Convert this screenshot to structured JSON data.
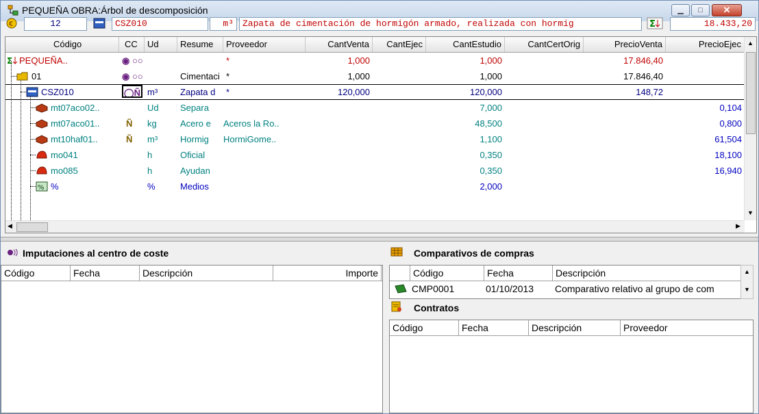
{
  "window": {
    "title": "PEQUEÑA OBRA:Árbol de descomposición"
  },
  "toolbar": {
    "quantity": "12",
    "code": "CSZ010",
    "unit": "m³",
    "description": "Zapata de cimentación de hormigón armado, realizada con hormig",
    "total": "18.433,20"
  },
  "grid": {
    "columns": [
      "Código",
      "CC",
      "Ud",
      "Resume",
      "Proveedor",
      "CantVenta",
      "CantEjec",
      "CantEstudio",
      "CantCertOrig",
      "PrecioVenta",
      "PrecioEjec"
    ],
    "rows": [
      {
        "code": "PEQUEÑA..",
        "ud": "",
        "resumen": "",
        "proveedor": "*",
        "cantventa": "1,000",
        "cantejec": "",
        "cantestudio": "1,000",
        "cantcert": "",
        "precioventa": "17.846,40",
        "precioejec": "",
        "color": "#c00000"
      },
      {
        "code": "01",
        "ud": "",
        "resumen": "Cimentaci",
        "proveedor": "*",
        "cantventa": "1,000",
        "cantejec": "",
        "cantestudio": "1,000",
        "cantcert": "",
        "precioventa": "17.846,40",
        "precioejec": "",
        "color": "#000000"
      },
      {
        "code": "CSZ010",
        "ud": "m³",
        "resumen": "Zapata d",
        "proveedor": "*",
        "cantventa": "120,000",
        "cantejec": "",
        "cantestudio": "120,000",
        "cantcert": "",
        "precioventa": "148,72",
        "precioejec": "",
        "color": "#000080"
      },
      {
        "code": "mt07aco02..",
        "ud": "Ud",
        "resumen": "Separa",
        "proveedor": "",
        "cantventa": "",
        "cantejec": "",
        "cantestudio": "7,000",
        "cantcert": "",
        "precioventa": "",
        "precioejec": "0,104",
        "color": "#008080"
      },
      {
        "code": "mt07aco01..",
        "ud": "kg",
        "resumen": "Acero e",
        "proveedor": "Aceros la Ro..",
        "cantventa": "",
        "cantejec": "",
        "cantestudio": "48,500",
        "cantcert": "",
        "precioventa": "",
        "precioejec": "0,800",
        "color": "#008080"
      },
      {
        "code": "mt10haf01..",
        "ud": "m³",
        "resumen": "Hormig",
        "proveedor": "HormiGome..",
        "cantventa": "",
        "cantejec": "",
        "cantestudio": "1,100",
        "cantcert": "",
        "precioventa": "",
        "precioejec": "61,504",
        "color": "#008080"
      },
      {
        "code": "mo041",
        "ud": "h",
        "resumen": "Oficial",
        "proveedor": "",
        "cantventa": "",
        "cantejec": "",
        "cantestudio": "0,350",
        "cantcert": "",
        "precioventa": "",
        "precioejec": "18,100",
        "color": "#008080"
      },
      {
        "code": "mo085",
        "ud": "h",
        "resumen": "Ayudan",
        "proveedor": "",
        "cantventa": "",
        "cantejec": "",
        "cantestudio": "0,350",
        "cantcert": "",
        "precioventa": "",
        "precioejec": "16,940",
        "color": "#008080"
      },
      {
        "code": "%",
        "ud": "%",
        "resumen": "Medios",
        "proveedor": "",
        "cantventa": "",
        "cantejec": "",
        "cantestudio": "2,000",
        "cantcert": "",
        "precioventa": "",
        "precioejec": "",
        "color": "#0000c0"
      }
    ]
  },
  "imputaciones": {
    "title": "Imputaciones al centro de coste",
    "columns": [
      "Código",
      "Fecha",
      "Descripción",
      "Importe"
    ]
  },
  "comparativos": {
    "title": "Comparativos de compras",
    "columns": [
      "Código",
      "Fecha",
      "Descripción"
    ],
    "rows": [
      {
        "code": "CMP0001",
        "fecha": "01/10/2013",
        "descripcion": "Comparativo relativo al grupo de com"
      }
    ]
  },
  "contratos": {
    "title": "Contratos",
    "columns": [
      "Código",
      "Fecha",
      "Descripción",
      "Proveedor"
    ]
  }
}
